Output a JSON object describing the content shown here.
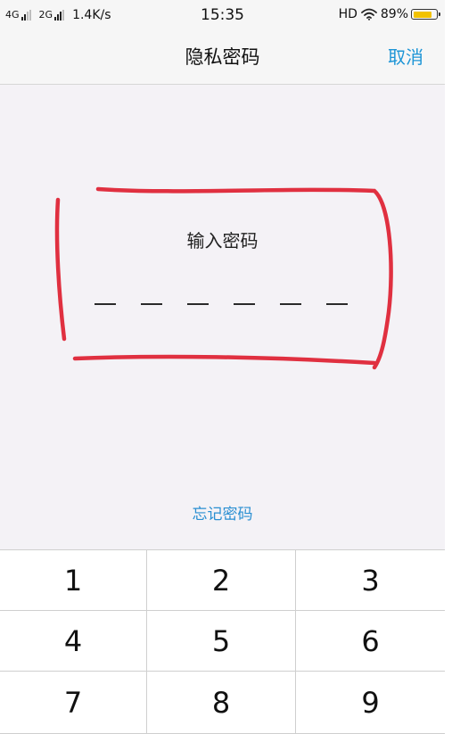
{
  "status_bar": {
    "network1": "4G",
    "network2": "2G",
    "speed": "1.4K/s",
    "time": "15:35",
    "hd": "HD",
    "battery_pct": "89%",
    "battery_level": 0.89,
    "battery_color": "#f2c200"
  },
  "nav": {
    "title": "隐私密码",
    "cancel_label": "取消"
  },
  "password": {
    "prompt": "输入密码",
    "slot_count": 6,
    "filled": 0
  },
  "forgot_label": "忘记密码",
  "keypad": {
    "keys": [
      "1",
      "2",
      "3",
      "4",
      "5",
      "6",
      "7",
      "8",
      "9"
    ]
  },
  "colors": {
    "accent": "#1d95d6",
    "annotation": "#e03040"
  },
  "icons": [
    "signal-icon",
    "wifi-icon",
    "battery-icon"
  ]
}
